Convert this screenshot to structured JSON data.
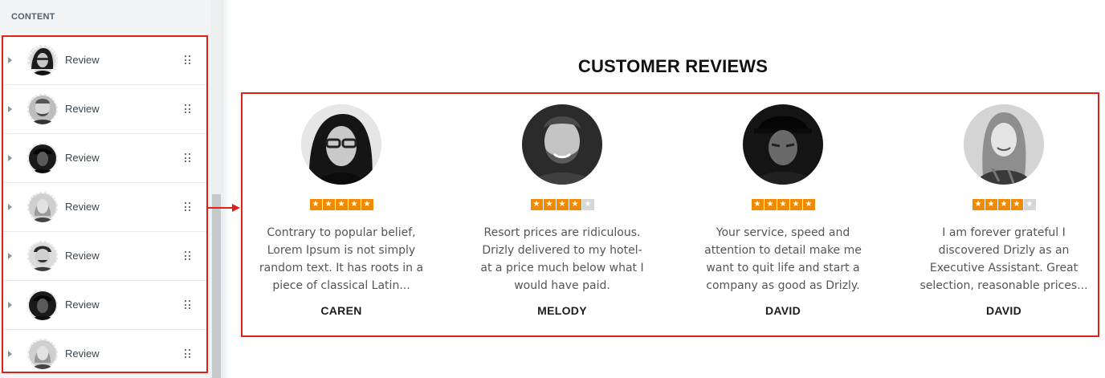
{
  "sidebar": {
    "section_label": "CONTENT",
    "items": [
      {
        "label": "Review",
        "thumb": "caren-thumbnail"
      },
      {
        "label": "Review",
        "thumb": "melody-thumbnail"
      },
      {
        "label": "Review",
        "thumb": "david-thumbnail"
      },
      {
        "label": "Review",
        "thumb": "woman-thumbnail"
      },
      {
        "label": "Review",
        "thumb": "man-laughing-thumbnail"
      },
      {
        "label": "Review",
        "thumb": "david-thumbnail"
      },
      {
        "label": "Review",
        "thumb": "woman-thumbnail"
      }
    ]
  },
  "section_title": "CUSTOMER REVIEWS",
  "reviews": [
    {
      "rating": 5,
      "text": "Contrary to popular belief, Lorem Ipsum is not simply random text. It has roots in a piece of classical Latin...",
      "name": "CAREN"
    },
    {
      "rating": 4,
      "text": "Resort prices are ridiculous. Drizly delivered to my hotel-at a price much below what I would have paid.",
      "name": "MELODY"
    },
    {
      "rating": 5,
      "text": "Your service, speed and attention to detail make me want to quit life and start a company as good as Drizly.",
      "name": "DAVID"
    },
    {
      "rating": 4,
      "text": "I am forever grateful I discovered Drizly as an Executive Assistant. Great selection, reasonable prices...",
      "name": "DAVID"
    }
  ],
  "rating_max": 5,
  "colors": {
    "highlight": "#e0201b",
    "star_on": "#f28a00",
    "star_off": "#d6d6d6"
  }
}
